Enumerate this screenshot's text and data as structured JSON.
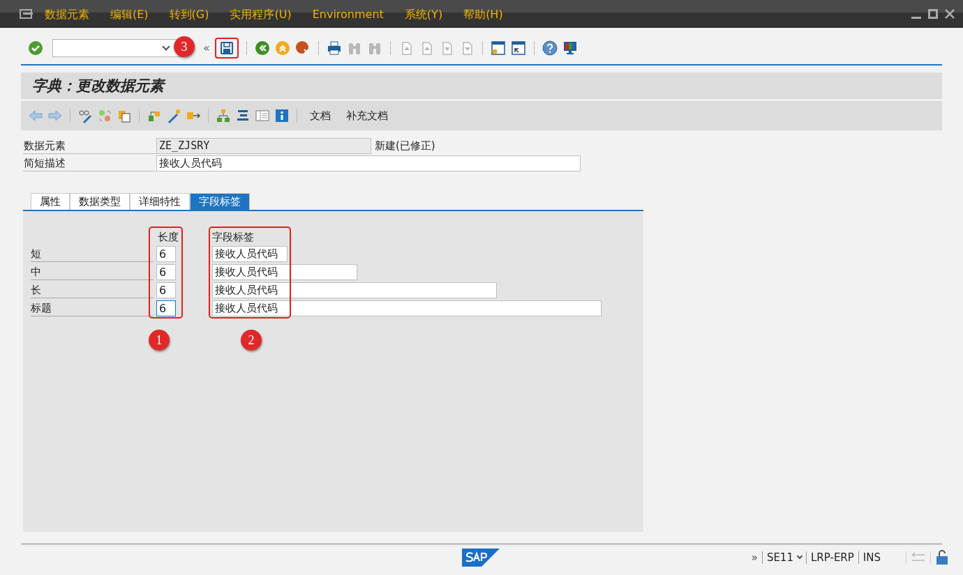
{
  "menu_bar": {
    "items": [
      "数据元素",
      "编辑(E)",
      "转到(G)",
      "实用程序(U)",
      "Environment",
      "系统(Y)",
      "帮助(H)"
    ]
  },
  "system_toolbar": {
    "collapse": "«",
    "groups": [
      [
        {
          "kind": "enter",
          "disabled": false
        },
        {
          "kind": "command",
          "disabled": false
        },
        {
          "kind": "save",
          "disabled": false
        }
      ],
      [
        {
          "kind": "back",
          "disabled": false
        },
        {
          "kind": "exit",
          "disabled": false
        },
        {
          "kind": "cancel",
          "disabled": false
        }
      ],
      [
        {
          "kind": "print",
          "disabled": false
        },
        {
          "kind": "find",
          "disabled": true
        },
        {
          "kind": "find-next",
          "disabled": true
        }
      ],
      [
        {
          "kind": "first-page",
          "disabled": true
        },
        {
          "kind": "prev-page",
          "disabled": true
        },
        {
          "kind": "next-page",
          "disabled": true
        },
        {
          "kind": "last-page",
          "disabled": true
        }
      ],
      [
        {
          "kind": "new-session",
          "disabled": false
        },
        {
          "kind": "shortcut",
          "disabled": false
        }
      ],
      [
        {
          "kind": "help",
          "disabled": false
        },
        {
          "kind": "layout",
          "disabled": false
        }
      ]
    ]
  },
  "title": "字典：更改数据元素",
  "app_toolbar": {
    "text_buttons": [
      "文档",
      "补充文档"
    ]
  },
  "header_fields": [
    {
      "label": "数据元素",
      "value": "ZE_ZJSRY",
      "readonly": true,
      "status": "新建(已修正)"
    },
    {
      "label": "简短描述",
      "value": "接收人员代码",
      "readonly": false
    }
  ],
  "tabs": [
    {
      "label": "属性",
      "selected": false
    },
    {
      "label": "数据类型",
      "selected": false
    },
    {
      "label": "详细特性",
      "selected": false
    },
    {
      "label": "字段标签",
      "selected": true
    }
  ],
  "field_labels": {
    "length_heading": "长度",
    "label_heading": "字段标签",
    "rows": [
      {
        "name": "短",
        "length": "6",
        "label": "接收人员代码"
      },
      {
        "name": "中",
        "length": "6",
        "label": "接收人员代码"
      },
      {
        "name": "长",
        "length": "6",
        "label": "接收人员代码"
      },
      {
        "name": "标题",
        "length": "6",
        "label": "接收人员代码"
      }
    ]
  },
  "annotations": [
    "1",
    "2",
    "3"
  ],
  "status_bar": {
    "overflow": "»",
    "transaction": "SE11",
    "system": "LRP-ERP",
    "mode": "INS"
  }
}
